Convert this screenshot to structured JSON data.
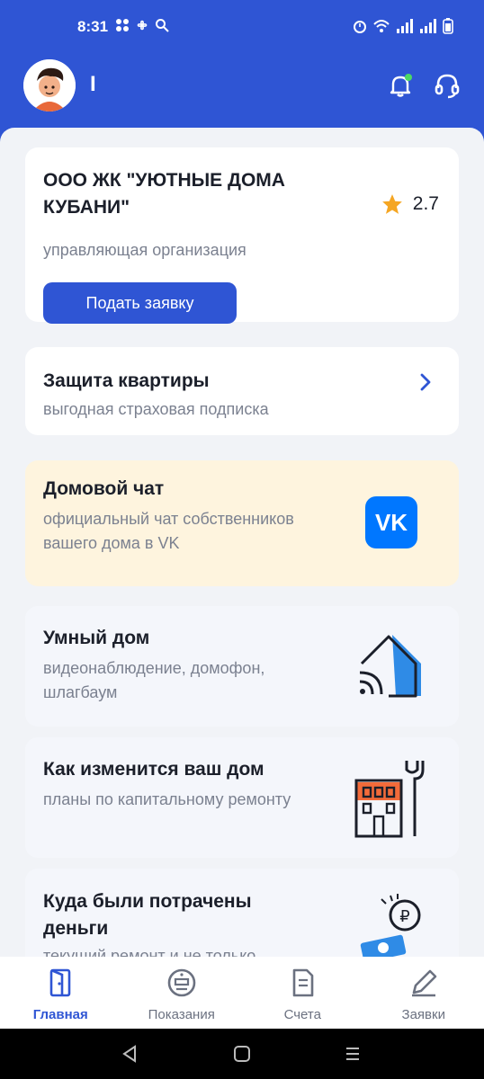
{
  "status_bar": {
    "time": "8:31"
  },
  "header": {
    "user_name": "I"
  },
  "org_card": {
    "title": "ООО ЖК \"УЮТНЫЕ ДОМА КУБАНИ\"",
    "subtitle": "управляющая организация",
    "rating": "2.7",
    "button_label": "Подать заявку"
  },
  "insurance_card": {
    "title": "Защита квартиры",
    "subtitle": "выгодная страховая подписка"
  },
  "chat_card": {
    "title": "Домовой чат",
    "subtitle": "официальный чат собственников вашего дома в VK",
    "icon_text": "VK"
  },
  "smart_home_card": {
    "title": "Умный дом",
    "subtitle": "видеонаблюдение, домофон, шлагбаум"
  },
  "repair_card": {
    "title": "Как изменится ваш дом",
    "subtitle": "планы по капитальному ремонту"
  },
  "money_card": {
    "title": "Куда были потрачены деньги",
    "subtitle": "текущий ремонт и не только"
  },
  "tabs": [
    {
      "label": "Главная",
      "icon": "door-icon",
      "active": true
    },
    {
      "label": "Показания",
      "icon": "meter-icon",
      "active": false
    },
    {
      "label": "Счета",
      "icon": "receipt-icon",
      "active": false
    },
    {
      "label": "Заявки",
      "icon": "pencil-icon",
      "active": false
    }
  ],
  "colors": {
    "primary": "#2f55d4",
    "star": "#f5a623",
    "vk": "#0077ff",
    "chat_bg": "#fef4de"
  }
}
